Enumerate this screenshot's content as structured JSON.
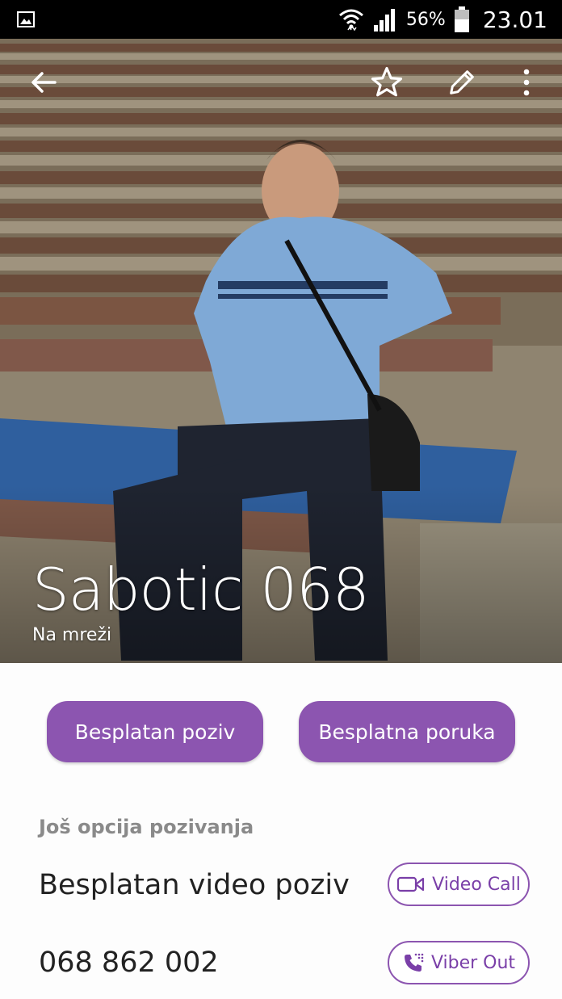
{
  "status_bar": {
    "battery_percent": "56%",
    "time": "23.01",
    "icons": [
      "gallery-icon",
      "wifi-icon",
      "signal-icon",
      "battery-icon"
    ]
  },
  "header": {
    "icons": [
      "back-arrow-icon",
      "star-icon",
      "pencil-icon",
      "more-vert-icon"
    ]
  },
  "contact": {
    "name": "Sabotic 068",
    "status": "Na mreži"
  },
  "actions": {
    "free_call_label": "Besplatan poziv",
    "free_message_label": "Besplatna poruka"
  },
  "more_options": {
    "title": "Još opcija pozivanja",
    "video_row_label": "Besplatan video poziv",
    "video_button_label": "Video Call",
    "phone_number": "068 862 002",
    "viber_out_label": "Viber Out"
  },
  "colors": {
    "accent": "#8c55b0",
    "accent_text": "#7a3fa8",
    "section_title": "#8a8a8a"
  }
}
